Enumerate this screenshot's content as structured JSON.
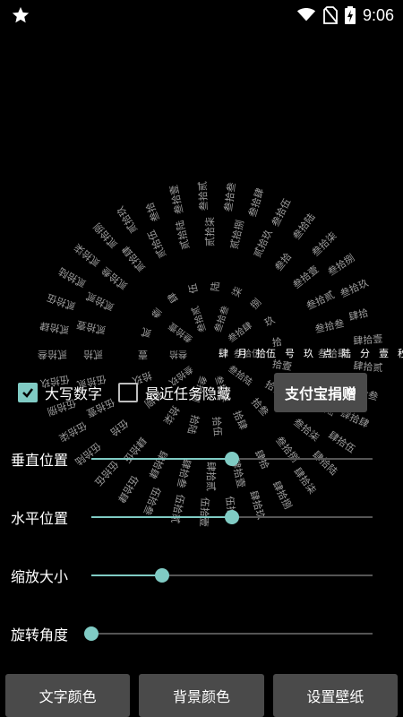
{
  "status_bar": {
    "time": "9:06",
    "icons": [
      "star-icon",
      "wifi-icon",
      "no-sim-icon",
      "battery-charging-icon"
    ]
  },
  "clock": {
    "rings": [
      [
        "贰拾叁",
        "贰拾肆",
        "贰拾伍",
        "贰拾陆",
        "贰拾柒",
        "贰拾捌",
        "贰拾玖",
        "叁拾",
        "叁拾壹",
        "叁拾贰",
        "叁拾叁",
        "叁拾肆",
        "叁拾伍",
        "叁拾陆",
        "叁拾柒",
        "叁拾捌",
        "叁拾玖",
        "肆拾",
        "肆拾壹",
        "肆拾贰",
        "肆拾叁",
        "肆拾肆",
        "肆拾伍",
        "肆拾陆",
        "肆拾柒",
        "肆拾捌",
        "肆拾玖",
        "伍拾",
        "伍拾壹",
        "伍拾贰",
        "伍拾叁",
        "伍拾肆",
        "伍拾伍",
        "伍拾陆",
        "伍拾柒",
        "伍拾捌",
        "伍拾玖"
      ],
      [
        "贰拾",
        "贰拾壹",
        "贰拾贰",
        "贰拾叁",
        "贰拾肆",
        "贰拾伍",
        "贰拾陆",
        "贰拾柒",
        "贰拾捌",
        "贰拾玖",
        "叁拾",
        "叁拾壹",
        "叁拾贰",
        "叁拾叁",
        "叁拾肆",
        "叁拾伍",
        "叁拾陆",
        "叁拾柒",
        "叁拾捌",
        "肆拾",
        "肆拾壹",
        "肆拾贰",
        "肆拾叁",
        "肆拾肆",
        "肆拾伍",
        "伍拾",
        "伍拾壹",
        "伍拾贰"
      ],
      [
        "壹",
        "贰",
        "叁",
        "肆",
        "伍",
        "陆",
        "柒",
        "捌",
        "玖",
        "拾",
        "拾壹",
        "拾贰",
        "拾叁",
        "拾肆",
        "拾伍",
        "拾陆",
        "拾柒",
        "拾捌",
        "拾玖"
      ],
      [
        "叁拾",
        "叁拾壹",
        "叁拾贰",
        "叁拾叁",
        "叁拾肆",
        "叁拾伍",
        "叁拾陆",
        "叁拾柒",
        "叁拾捌",
        "叁拾玖"
      ]
    ],
    "readout": [
      "肆",
      "月",
      "拾伍",
      "号",
      "玖",
      "点",
      "陆",
      "分",
      "壹",
      "秒"
    ]
  },
  "controls": {
    "uppercase_label": "大写数字",
    "uppercase_checked": true,
    "hide_recent_label": "最近任务隐藏",
    "hide_recent_checked": false,
    "alipay_label": "支付宝捐赠"
  },
  "sliders": [
    {
      "label": "垂直位置",
      "value": 0.5
    },
    {
      "label": "水平位置",
      "value": 0.5
    },
    {
      "label": "缩放大小",
      "value": 0.25
    },
    {
      "label": "旋转角度",
      "value": 0.0
    }
  ],
  "buttons": {
    "text_color": "文字颜色",
    "bg_color": "背景颜色",
    "set_wallpaper": "设置壁纸"
  },
  "accent_color": "#80cbc4",
  "button_bg_color": "#4a4a4a"
}
